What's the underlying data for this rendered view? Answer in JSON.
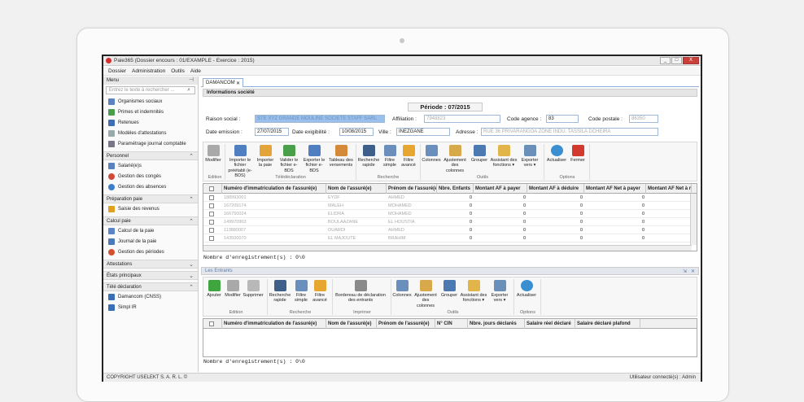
{
  "window": {
    "title": "Paie365 (Dossier encours : 01/EXAMPLE - Exercice : 2015)",
    "minimize": "_",
    "maximize": "□",
    "close": "X"
  },
  "menu": [
    "Dossier",
    "Administration",
    "Outils",
    "Aide"
  ],
  "sidebar": {
    "header": "Menu",
    "search_placeholder": "Entrez le texte à rechercher ...",
    "top_items": [
      "Organismes sociaux",
      "Primes et indemnités",
      "Retenues",
      "Modèles d'attestations",
      "Paramétrage journal comptable"
    ],
    "groups": [
      {
        "title": "Personnel",
        "items": [
          "Salarié(e)s",
          "Gestion des congés",
          "Gestion des absences"
        ]
      },
      {
        "title": "Préparation paie",
        "items": [
          "Saisie des revenus"
        ]
      },
      {
        "title": "Calcul paie",
        "items": [
          "Calcul de la paie",
          "Journal de la paie",
          "Gestion des périodes"
        ]
      },
      {
        "title": "Attestations",
        "items": []
      },
      {
        "title": "États principaux",
        "items": []
      },
      {
        "title": "Télé déclaration",
        "items": [
          "Damancom (CNSS)",
          "Simpl IR"
        ]
      }
    ]
  },
  "tab": {
    "label": "DAMANCOM",
    "close": "✕"
  },
  "info": {
    "title": "Informations société",
    "periode": "Période : 07/2015",
    "raison_label": "Raison social :",
    "raison_value": "STE XYZ GRANDE MOULINE SOCIETE STAFF SARL",
    "affiliation_label": "Affiliation :",
    "affiliation_value": "7948823",
    "code_agence_label": "Code agence :",
    "code_agence_value": "83",
    "code_postal_label": "Code postale :",
    "code_postal_value": "86350",
    "date_emission_label": "Date emission :",
    "date_emission_value": "27/07/2015",
    "date_exig_label": "Date exigibilité :",
    "date_exig_value": "10/08/2015",
    "ville_label": "Ville :",
    "ville_value": "INEZGANE",
    "adresse_label": "Adresse :",
    "adresse_value": "RUE 36 PRIVARANGOA ZONE INDU. TASSILA DCHEIRA"
  },
  "ribbon1": {
    "buttons": [
      "Modifier",
      "Importer le fichier préétabli (e-BDS)",
      "Importer la paie",
      "Valider le fichier e-BDS",
      "Exporter le fichier e-BDS",
      "Tableau des versements",
      "Recherche rapide",
      "Filtre simple",
      "Filtre avancé",
      "Colonnes",
      "Ajustement des colonnes",
      "Grouper",
      "Assistant des fonctions ▾",
      "Exporter vers ▾",
      "Actualiser",
      "Fermer"
    ],
    "sections": [
      "Edition",
      "Télédéclaration",
      "Recherche",
      "Outils",
      "Options"
    ]
  },
  "grid1": {
    "columns": [
      "",
      "Numéro d'immatriculation de l'assuré(e)",
      "Nom de l'assuré(e)",
      "Prénom de l'assuré(e)",
      "Nbre. Enfants",
      "Montant AF à payer",
      "Montant AF à déduire",
      "Montant AF Net à payer",
      "Montant AF Net à rev"
    ],
    "rows": [
      [
        "",
        "188993001",
        "EYDF",
        "AHMED",
        "0",
        "0",
        "0",
        "0",
        ""
      ],
      [
        "",
        "167209174",
        "MALEH",
        "MOHAMED",
        "0",
        "0",
        "0",
        "0",
        ""
      ],
      [
        "",
        "166750024",
        "ELIDRA",
        "MOHAMED",
        "0",
        "0",
        "0",
        "0",
        ""
      ],
      [
        "",
        "149970903",
        "BOULAAZANE",
        "EL HOUSTIA",
        "0",
        "0",
        "0",
        "0",
        ""
      ],
      [
        "",
        "113880007",
        "OUARDI",
        "AHMED",
        "0",
        "0",
        "0",
        "0",
        ""
      ],
      [
        "",
        "143500070",
        "EL MAJOUTE",
        "BRAHIM",
        "0",
        "0",
        "0",
        "0",
        ""
      ]
    ],
    "count": "Nombre d'enregistrement(s) : 0\\0"
  },
  "entrants": {
    "title": "Les Entrants",
    "pin": "⇲",
    "close": "✕"
  },
  "ribbon2": {
    "buttons": [
      "Ajouter",
      "Modifier",
      "Supprimer",
      "Recherche rapide",
      "Filtre simple",
      "Filtre avancé",
      "Bordereau de déclaration des entrants",
      "Colonnes",
      "Ajustement des colonnes",
      "Grouper",
      "Assistant des fonctions ▾",
      "Exporter vers ▾",
      "Actualiser"
    ],
    "sections": [
      "Edition",
      "Recherche",
      "Imprimer",
      "Outils",
      "Options"
    ]
  },
  "grid2": {
    "columns": [
      "",
      "Numéro d'immatriculation de l'assuré(e)",
      "Nom de l'assuré(e)",
      "Prénom de l'assuré(e)",
      "N° CIN",
      "Nbre. jours déclarés",
      "Salaire réel déclaré",
      "Salaire déclaré plafond"
    ],
    "count": "Nombre d'enregistrement(s) : 0\\0"
  },
  "status": {
    "left": "COPYRIGHT USELEKT S. A. R. L. ©",
    "right": "Utilisateur connecté(s) : Admin"
  }
}
